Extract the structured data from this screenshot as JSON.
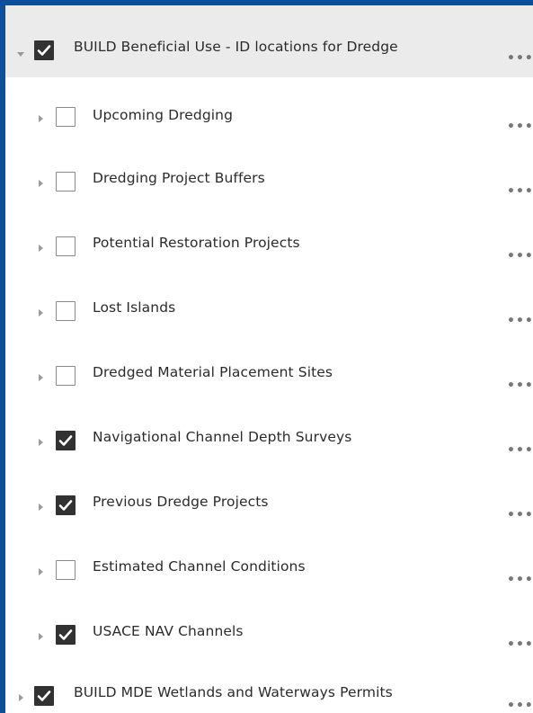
{
  "layers": {
    "group_top": {
      "label": "BUILD Beneficial Use - ID locations for Dredge",
      "checked": true,
      "expanded": true,
      "more": "•••"
    },
    "children": [
      {
        "label": "Upcoming Dredging",
        "checked": false,
        "more": "•••"
      },
      {
        "label": "Dredging Project Buffers",
        "checked": false,
        "more": "•••"
      },
      {
        "label": "Potential Restoration Projects",
        "checked": false,
        "more": "•••"
      },
      {
        "label": "Lost Islands",
        "checked": false,
        "more": "•••"
      },
      {
        "label": "Dredged Material Placement Sites",
        "checked": false,
        "more": "•••"
      },
      {
        "label": "Navigational Channel Depth Surveys",
        "checked": true,
        "more": "•••"
      },
      {
        "label": "Previous Dredge Projects",
        "checked": true,
        "more": "•••"
      },
      {
        "label": "Estimated Channel Conditions",
        "checked": false,
        "more": "•••"
      },
      {
        "label": "USACE NAV Channels",
        "checked": true,
        "more": "•••"
      }
    ],
    "group_bottom": {
      "label": "BUILD MDE Wetlands and Waterways Permits",
      "checked": true,
      "expanded": false,
      "more": "•••"
    }
  },
  "colors": {
    "frame_border": "#0d4f9c",
    "checkbox_checked": "#323232",
    "group_header_bg": "#ebebeb"
  },
  "icons": {
    "expand_open": "caret-down-icon",
    "expand_closed": "caret-right-icon",
    "check": "check-icon",
    "more": "more-options-icon"
  }
}
